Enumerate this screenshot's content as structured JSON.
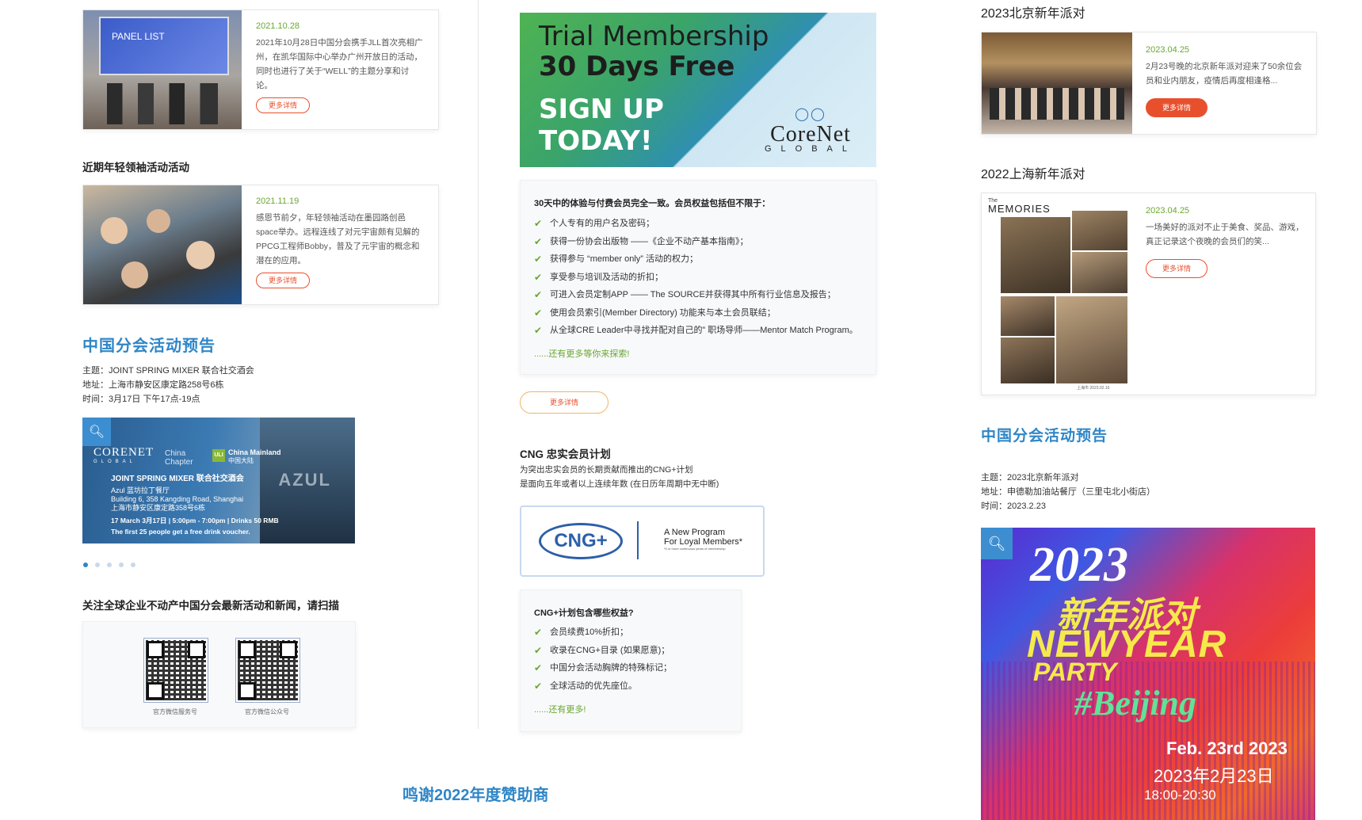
{
  "left": {
    "event1": {
      "photo_title": "PANEL LIST",
      "date": "2021.10.28",
      "desc": "2021年10月28日中国分会携手JLL首次亮相广州，在凯华国际中心举办广州开放日的活动，同时也进行了关于“WELL”的主题分享和讨论。",
      "more": "更多详情"
    },
    "young_title": "近期年轻领袖活动活动",
    "event2": {
      "date": "2021.11.19",
      "desc": "感恩节前夕，年轻领袖活动在墨园路创邑space举办。远程连线了对元宇宙颇有见解的 PPCG工程师Bobby，普及了元宇宙的概念和潜在的应用。",
      "more": "更多详情"
    },
    "preview_title": "中国分会活动预告",
    "preview": {
      "subject": "主题：JOINT SPRING MIXER 联合社交酒会",
      "address": "地址：上海市静安区康定路258号6栋",
      "time": "时间：3月17日 下午17点-19点"
    },
    "poster": {
      "brand": "CORENET",
      "brand_sub": "GLOBAL",
      "chapter": "China Chapter",
      "uli": "ULI",
      "uli_text": "China Mainland",
      "uli_cn": "中国大陆",
      "title": "JOINT SPRING MIXER 联合社交酒会",
      "venue1": "Azul 蓝坊拉丁餐厅",
      "venue2": "Building 6, 358 Kangding Road, Shanghai",
      "venue3": "上海市静安区康定路358号6栋",
      "when": "17 March 3月17日 | 5:00pm - 7:00pm | Drinks 50 RMB",
      "note": "The first 25 people get a free drink voucher.",
      "sign": "AZUL"
    },
    "follow_title": "关注全球企业不动产中国分会最新活动和新闻，请扫描",
    "qr1_label": "官方微信服务号",
    "qr2_label": "官方微信公众号"
  },
  "middle": {
    "banner": {
      "line1": "Trial Membership",
      "line2": "30 Days Free",
      "line3": "SIGN UP",
      "line4": "TODAY!",
      "logo": "CoreNet",
      "logo_sub": "GLOBAL"
    },
    "benefits_title": "30天中的体验与付费会员完全一致。会员权益包括但不限于：",
    "benefits": [
      "个人专有的用户名及密码；",
      "获得一份协会出版物 ——《企业不动产基本指南》；",
      "获得参与 “member only” 活动的权力；",
      "享受参与培训及活动的折扣；",
      "可进入会员定制APP —— The SOURCE并获得其中所有行业信息及报告；",
      "使用会员索引(Member Directory) 功能来与本土会员联结；",
      "从全球CRE Leader中寻找并配对自己的” 职场导师——Mentor Match Program。"
    ],
    "benefits_more": "......还有更多等你来探索!",
    "more": "更多详情",
    "cng_title": "CNG 忠实会员计划",
    "cng_desc1": "为突出忠实会员的长期贡献而推出的CNG+计划",
    "cng_desc2": "是面向五年或者以上连续年数 (在日历年周期中无中断)",
    "cng_logo": "CNG+",
    "cng_tag1": "A New Program",
    "cng_tag2": "For Loyal Members*",
    "cng_tag3": "*5 or more continuous years of membership",
    "cng_q": "CNG+计划包含哪些权益?",
    "cng_list": [
      "会员续费10%折扣；",
      "收录在CNG+目录 (如果愿意)；",
      "中国分会活动胸牌的特殊标记；",
      "全球活动的优先座位。"
    ],
    "cng_more": "......还有更多!",
    "sponsor_title": "鸣谢2022年度赞助商"
  },
  "right": {
    "party1_title": "2023北京新年派对",
    "party1": {
      "date": "2023.04.25",
      "desc": "2月23号晚的北京新年派对迎来了50余位会员和业内朋友，疫情后再度相逢格...",
      "more": "更多详情"
    },
    "party2_title": "2022上海新年派对",
    "party2": {
      "memories": "MEMORIES",
      "memories_pre": "The",
      "caption": "上海市    2023.02.16",
      "date": "2023.04.25",
      "desc": "一场美好的派对不止于美食、奖品、游戏，真正记录这个夜晚的会员们的笑...",
      "more": "更多详情"
    },
    "preview_title": "中国分会活动预告",
    "preview": {
      "subject": "主题：2023北京新年派对",
      "address": "地址：申德勒加油站餐厅（三里屯北小街店）",
      "time": "时间：2023.2.23"
    },
    "poster": {
      "year": "2023",
      "cn": "新年派对",
      "en1": "NEWYEAR",
      "en2": "PARTY",
      "tag": "#Beijing",
      "date_en": "Feb. 23rd 2023",
      "date_cn": "2023年2月23日",
      "time": "18:00-20:30"
    }
  },
  "colors": {
    "accent_blue": "#2f86c7",
    "orange": "#e8502d",
    "green": "#6aa72f"
  }
}
